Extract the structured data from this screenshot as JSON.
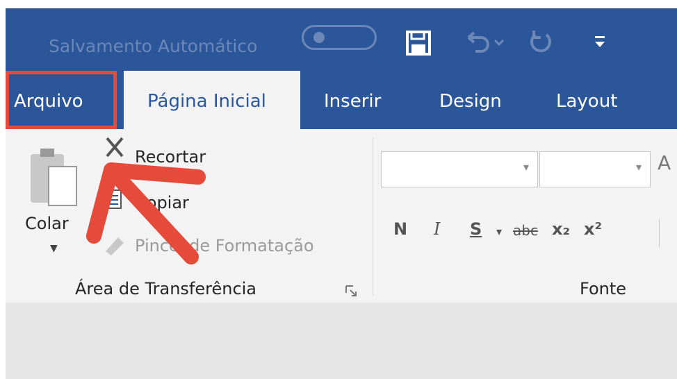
{
  "titlebar": {
    "autosave_label": "Salvamento Automático",
    "save_icon": "save-icon",
    "undo_icon": "undo-icon",
    "redo_icon": "redo-icon",
    "qat_icon": "customize-quick-access-icon"
  },
  "tabs": [
    {
      "label": "Arquivo"
    },
    {
      "label": "Página Inicial"
    },
    {
      "label": "Inserir"
    },
    {
      "label": "Design"
    },
    {
      "label": "Layout"
    }
  ],
  "clipboard": {
    "paste_label": "Colar",
    "cut_label": "Recortar",
    "copy_label": "Copiar",
    "painter_label": "Pincel de Formatação",
    "group_label": "Área de Transferência"
  },
  "font": {
    "group_label": "Fonte",
    "name_value": "",
    "size_value": "",
    "grow_label": "A",
    "bold": "N",
    "italic": "I",
    "underline": "S",
    "strike": "abc",
    "subscript": "x₂",
    "superscript": "x²"
  },
  "colors": {
    "accent": "#2b579a",
    "annotation": "#e64a3b"
  }
}
